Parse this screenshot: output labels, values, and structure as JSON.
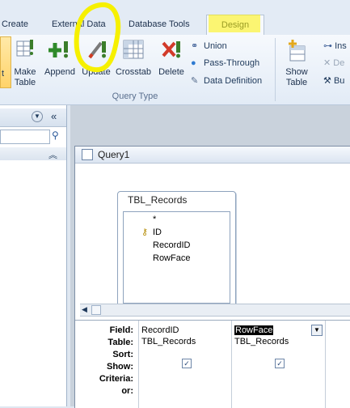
{
  "tabs": [
    "Create",
    "External Data",
    "Database Tools",
    "Design"
  ],
  "ribbon": {
    "query_type": {
      "buttons": [
        {
          "label": "Make\nTable",
          "icon": "make-table-icon"
        },
        {
          "label": "Append",
          "icon": "append-icon"
        },
        {
          "label": "Update",
          "icon": "update-icon"
        },
        {
          "label": "Crosstab",
          "icon": "crosstab-icon"
        },
        {
          "label": "Delete",
          "icon": "delete-icon"
        }
      ],
      "small": [
        "Union",
        "Pass-Through",
        "Data Definition"
      ],
      "group_label": "Query Type"
    },
    "show_table": "Show\nTable",
    "right_items": [
      "Ins",
      "De",
      "Bu"
    ]
  },
  "query": {
    "title": "Query1",
    "table": {
      "name": "TBL_Records",
      "fields": [
        "*",
        "ID",
        "RecordID",
        "RowFace"
      ]
    },
    "grid": {
      "row_labels": [
        "Field:",
        "Table:",
        "Sort:",
        "Show:",
        "Criteria:",
        "or:"
      ],
      "columns": [
        {
          "field": "RecordID",
          "table": "TBL_Records",
          "show": true
        },
        {
          "field": "RowFace",
          "table": "TBL_Records",
          "show": true
        }
      ]
    }
  }
}
